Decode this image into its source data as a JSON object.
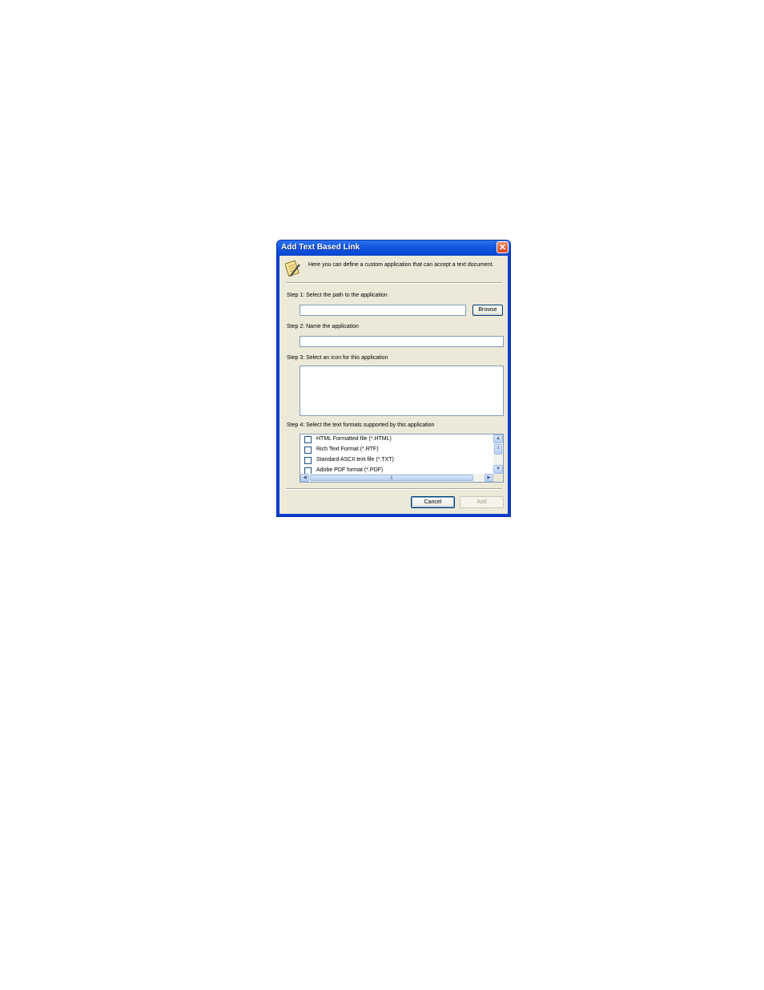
{
  "dialog": {
    "title": "Add Text Based Link",
    "close_label": "✕",
    "intro": "Here you can define a custom application that can accept a text document.",
    "step1": {
      "label": "Step 1: Select the path to the application",
      "value": "",
      "browse_label": "Browse"
    },
    "step2": {
      "label": "Step 2: Name the application",
      "value": ""
    },
    "step3": {
      "label": "Step 3: Select an icon for this application"
    },
    "step4": {
      "label": "Step 4: Select the text formats supported by this application",
      "formats": [
        {
          "label": "HTML Formatted file (*.HTML)",
          "checked": false
        },
        {
          "label": "Rich Text Format (*.RTF)",
          "checked": false
        },
        {
          "label": "Standard ASCII text file (*.TXT)",
          "checked": false
        },
        {
          "label": "Adobe PDF format (*.PDF)",
          "checked": false
        }
      ]
    },
    "cancel_label": "Cancel",
    "add_label": "Add"
  },
  "colors": {
    "title_bar": "#0b4bd8",
    "dialog_face": "#ece9d8",
    "close_button": "#d8431f"
  }
}
